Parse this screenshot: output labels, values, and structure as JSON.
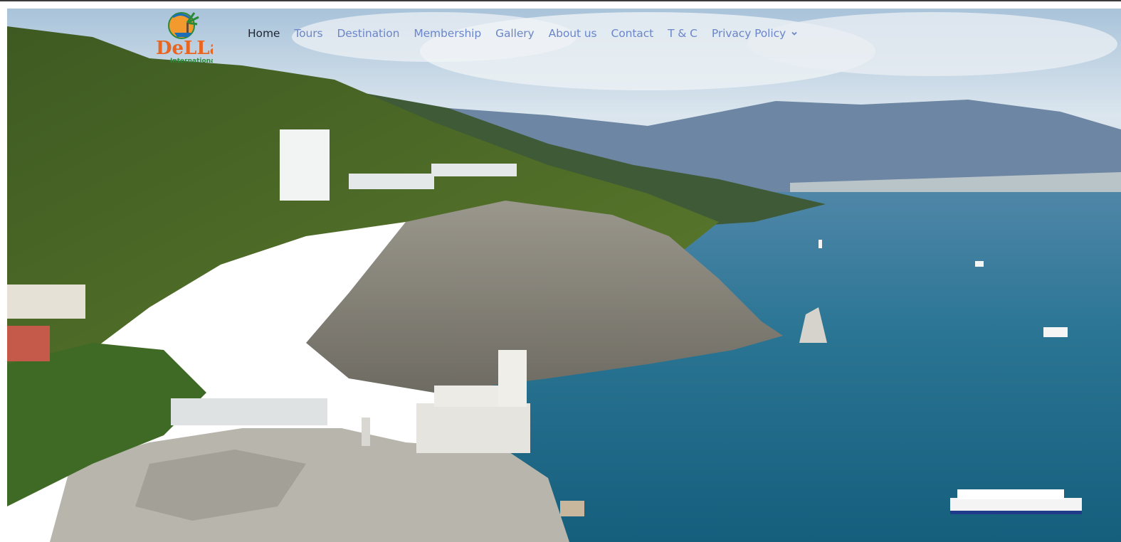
{
  "nav": {
    "items": [
      {
        "label": "Home",
        "active": true
      },
      {
        "label": "Tours"
      },
      {
        "label": "Destination"
      },
      {
        "label": "Membership"
      },
      {
        "label": "Gallery"
      },
      {
        "label": "About us"
      },
      {
        "label": "Contact"
      },
      {
        "label": "T & C"
      },
      {
        "label": "Privacy Policy",
        "has_dropdown": true
      }
    ]
  },
  "logo": {
    "text": "DeLLa",
    "subtext": "International",
    "icon": "globe-palm-logo"
  },
  "colors": {
    "nav_link": "#6b86c9",
    "nav_active": "#1f2533",
    "sea": "#1f6f8b",
    "sky": "#c9dbe9"
  }
}
